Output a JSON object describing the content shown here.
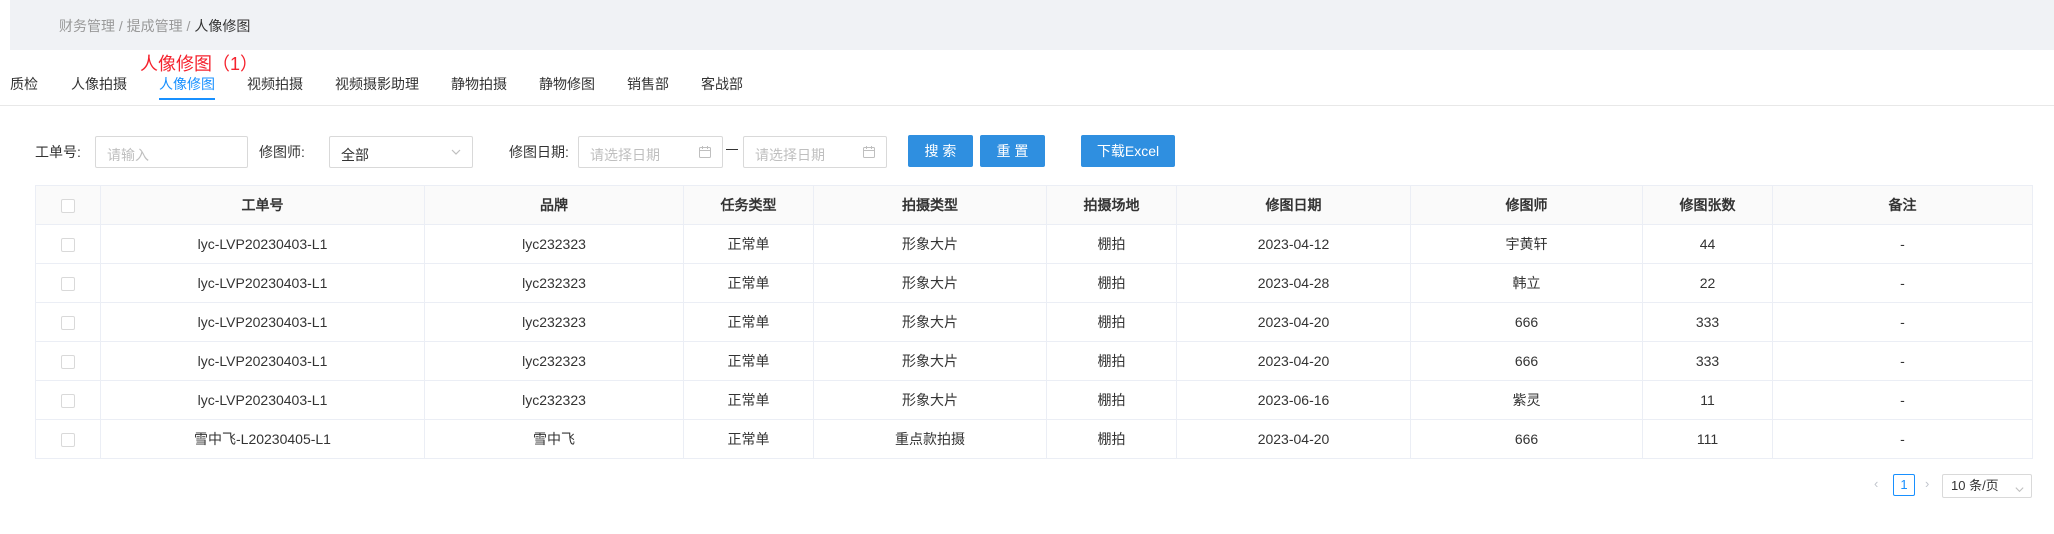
{
  "breadcrumb": {
    "item1": "财务管理",
    "sep1": " / ",
    "item2": "提成管理",
    "sep2": " / ",
    "current": "人像修图"
  },
  "tabs": [
    "质检",
    "人像拍摄",
    "人像修图",
    "视频拍摄",
    "视频摄影助理",
    "静物拍摄",
    "静物修图",
    "销售部",
    "客战部"
  ],
  "active_tab": "人像修图",
  "tab_note": "人像修图（1）",
  "filters": {
    "order_label": "工单号:",
    "order_placeholder": "请输入",
    "retoucher_label": "修图师:",
    "retoucher_value": "全部",
    "date_label": "修图日期:",
    "date_start_placeholder": "请选择日期",
    "date_end_placeholder": "请选择日期"
  },
  "buttons": {
    "search": "搜 索",
    "reset": "重 置",
    "export": "下载Excel"
  },
  "table": {
    "columns": [
      "工单号",
      "品牌",
      "任务类型",
      "拍摄类型",
      "拍摄场地",
      "修图日期",
      "修图师",
      "修图张数",
      "备注"
    ],
    "rows": [
      [
        "lyc-LVP20230403-L1",
        "lyc232323",
        "正常单",
        "形象大片",
        "棚拍",
        "2023-04-12",
        "宇黄轩",
        "44",
        "-"
      ],
      [
        "lyc-LVP20230403-L1",
        "lyc232323",
        "正常单",
        "形象大片",
        "棚拍",
        "2023-04-28",
        "韩立",
        "22",
        "-"
      ],
      [
        "lyc-LVP20230403-L1",
        "lyc232323",
        "正常单",
        "形象大片",
        "棚拍",
        "2023-04-20",
        "666",
        "333",
        "-"
      ],
      [
        "lyc-LVP20230403-L1",
        "lyc232323",
        "正常单",
        "形象大片",
        "棚拍",
        "2023-04-20",
        "666",
        "333",
        "-"
      ],
      [
        "lyc-LVP20230403-L1",
        "lyc232323",
        "正常单",
        "形象大片",
        "棚拍",
        "2023-06-16",
        "紫灵",
        "11",
        "-"
      ],
      [
        "雪中飞-L20230405-L1",
        "雪中飞",
        "正常单",
        "重点款拍摄",
        "棚拍",
        "2023-04-20",
        "666",
        "111",
        "-"
      ]
    ]
  },
  "pagination": {
    "current_page": "1",
    "page_size": "10 条/页"
  },
  "colors": {
    "primary": "#1890ff",
    "button": "#2f8fe0",
    "note": "#f5222d"
  }
}
